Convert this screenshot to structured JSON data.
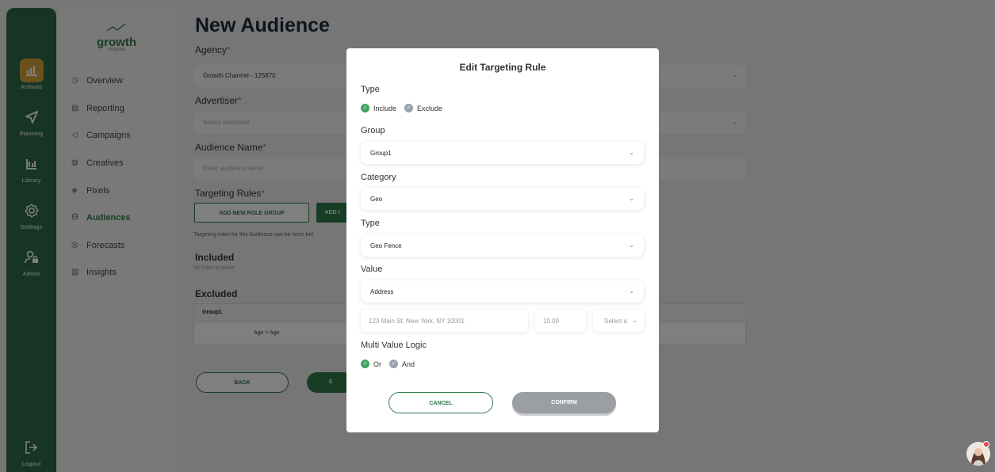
{
  "rail": {
    "items": [
      {
        "label": "Activate",
        "icon": "bar-chart-icon",
        "active": true
      },
      {
        "label": "Planning",
        "icon": "send-icon",
        "active": false
      },
      {
        "label": "Library",
        "icon": "library-icon",
        "active": false
      },
      {
        "label": "Settings",
        "icon": "gear-icon",
        "active": false
      },
      {
        "label": "Admin",
        "icon": "user-lock-icon",
        "active": false
      }
    ],
    "logout": {
      "label": "Logout",
      "icon": "logout-icon"
    }
  },
  "sidebar": {
    "logo": {
      "word": "growth",
      "sub": "channel"
    },
    "items": [
      {
        "label": "Overview",
        "icon": "clock-icon",
        "active": false
      },
      {
        "label": "Reporting",
        "icon": "report-icon",
        "active": false
      },
      {
        "label": "Campaigns",
        "icon": "megaphone-icon",
        "active": false
      },
      {
        "label": "Creatives",
        "icon": "palette-icon",
        "active": false
      },
      {
        "label": "Pixels",
        "icon": "pixel-icon",
        "active": false
      },
      {
        "label": "Audiences",
        "icon": "users-icon",
        "active": true
      },
      {
        "label": "Forecasts",
        "icon": "eye-icon",
        "active": false
      },
      {
        "label": "Insights",
        "icon": "insights-icon",
        "active": false
      }
    ]
  },
  "page": {
    "title": "New Audience",
    "agency": {
      "label": "Agency",
      "value": "Growth Channel - 125870"
    },
    "advertiser": {
      "label": "Advertiser",
      "placeholder": "Select advertiser"
    },
    "audience_name": {
      "label": "Audience Name",
      "placeholder": "Enter audience name"
    },
    "targeting_rules": {
      "label": "Targeting Rules",
      "add_group_btn": "ADD NEW ROLE GROUP",
      "add_btn": "ADD I",
      "note": "Targeting rules for this Audience can be seen bel"
    },
    "included": {
      "label": "Included",
      "empty": "No rules in place"
    },
    "excluded": {
      "label": "Excluded",
      "group_header": "Group1",
      "row": "Age > Age"
    },
    "back_btn": "BACK",
    "save_btn": "S",
    "required_mark": "*"
  },
  "modal": {
    "title": "Edit Targeting Rule",
    "type_label": "Type",
    "type_options": [
      {
        "label": "Include",
        "checked": true
      },
      {
        "label": "Exclude",
        "checked": false
      }
    ],
    "group_label": "Group",
    "group_value": "Group1",
    "category_label": "Category",
    "category_value": "Geo",
    "type2_label": "Type",
    "type2_value": "Geo Fence",
    "value_label": "Value",
    "value_value": "Address",
    "address_placeholder": "123 Main St, New York, NY 10001",
    "radius_placeholder": "10.00",
    "unit_placeholder": "Select a",
    "logic_label": "Multi Value Logic",
    "logic_options": [
      {
        "label": "Or",
        "checked": true
      },
      {
        "label": "And",
        "checked": false
      }
    ],
    "cancel": "CANCEL",
    "confirm": "CONFIRM"
  },
  "colors": {
    "brand_green": "#2f7a4a",
    "rail_green": "#2f6b48",
    "accent_gold": "#d8a23a",
    "check_green": "#3ea35f"
  }
}
